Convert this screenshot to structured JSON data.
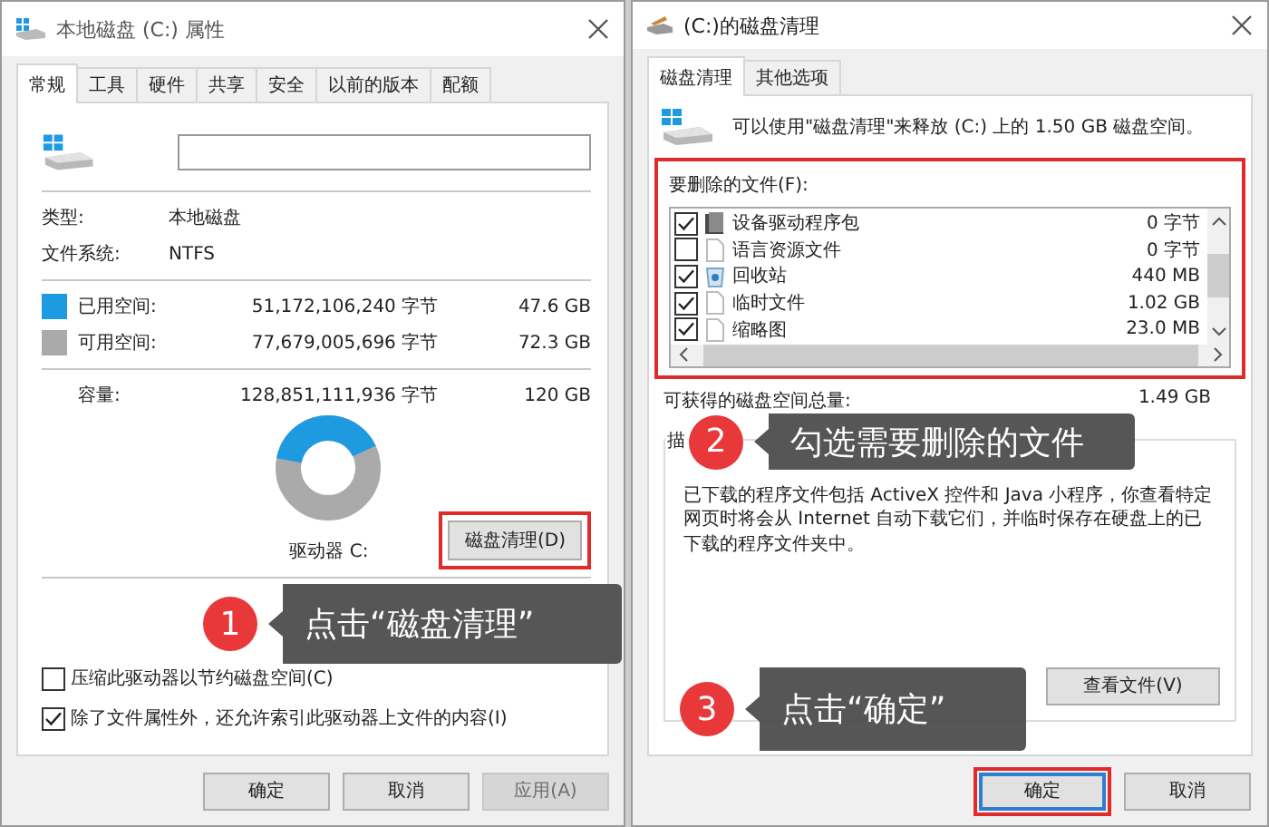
{
  "left_window": {
    "title": "本地磁盘 (C:) 属性",
    "tabs": [
      {
        "label": "常规",
        "selected": true
      },
      {
        "label": "工具",
        "selected": false
      },
      {
        "label": "硬件",
        "selected": false
      },
      {
        "label": "共享",
        "selected": false
      },
      {
        "label": "安全",
        "selected": false
      },
      {
        "label": "以前的版本",
        "selected": false
      },
      {
        "label": "配额",
        "selected": false
      }
    ],
    "properties": [
      {
        "label": "类型:",
        "value": "本地磁盘"
      },
      {
        "label": "文件系统:",
        "value": "NTFS"
      }
    ],
    "space": [
      {
        "label": "已用空间:",
        "bytes": "51,172,106,240 字节",
        "size": "47.6 GB",
        "color": "#1e9ae0"
      },
      {
        "label": "可用空间:",
        "bytes": "77,679,005,696 字节",
        "size": "72.3 GB",
        "color": "#aaaaaa"
      }
    ],
    "capacity": {
      "label": "容量:",
      "bytes": "128,851,111,936 字节",
      "size": "120 GB"
    },
    "usage": {
      "level": 0.4
    },
    "drive_label": "驱动器 C:",
    "cleanup_button": {
      "label": "磁盘清理(D)",
      "highlighted": true
    },
    "options": [
      {
        "label": "压缩此驱动器以节约磁盘空间(C)",
        "checked": false
      },
      {
        "label": "除了文件属性外，还允许索引此驱动器上文件的内容(I)",
        "checked": true
      }
    ],
    "buttons": [
      {
        "label": "确定",
        "disabled": false
      },
      {
        "label": "取消",
        "disabled": false
      },
      {
        "label": "应用(A)",
        "disabled": true
      }
    ]
  },
  "right_window": {
    "title": "(C:)的磁盘清理",
    "tabs": [
      {
        "label": "磁盘清理",
        "selected": true
      },
      {
        "label": "其他选项",
        "selected": false
      }
    ],
    "message": "可以使用\"磁盘清理\"来释放 (C:) 上的 1.50 GB 磁盘空间。",
    "files_group": {
      "label": "要删除的文件(F):",
      "highlighted": true,
      "items": [
        {
          "name": "设备驱动程序包",
          "size": "0 字节",
          "checked": true,
          "kind": "package"
        },
        {
          "name": "语言资源文件",
          "size": "0 字节",
          "checked": false,
          "kind": "file"
        },
        {
          "name": "回收站",
          "size": "440 MB",
          "checked": true,
          "kind": "recycle"
        },
        {
          "name": "临时文件",
          "size": "1.02 GB",
          "checked": true,
          "kind": "file"
        },
        {
          "name": "缩略图",
          "size": "23.0 MB",
          "checked": true,
          "kind": "file"
        }
      ]
    },
    "total": {
      "label": "可获得的磁盘空间总量:",
      "value": "1.49 GB"
    },
    "description": {
      "legend": "描",
      "text": "已下载的程序文件包括 ActiveX 控件和 Java 小程序，你查看特定网页时将会从 Internet 自动下载它们，并临时保存在硬盘上的已下载的程序文件夹中。",
      "button": "查看文件(V)"
    },
    "buttons": [
      {
        "label": "确定",
        "highlighted": true
      },
      {
        "label": "取消",
        "highlighted": false
      }
    ]
  },
  "callouts": [
    {
      "number": "1",
      "text": "点击“磁盘清理”"
    },
    {
      "number": "2",
      "text": "勾选需要删除的文件"
    },
    {
      "number": "3",
      "text": "点击“确定”"
    }
  ]
}
